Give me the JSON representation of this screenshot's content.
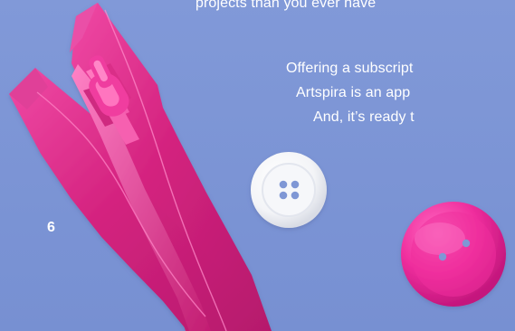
{
  "page": {
    "top_line": "projects than you ever have",
    "lines": [
      "Offering a subscript",
      "Artspira is an app",
      "And, it’s ready t"
    ],
    "page_number": "6"
  }
}
